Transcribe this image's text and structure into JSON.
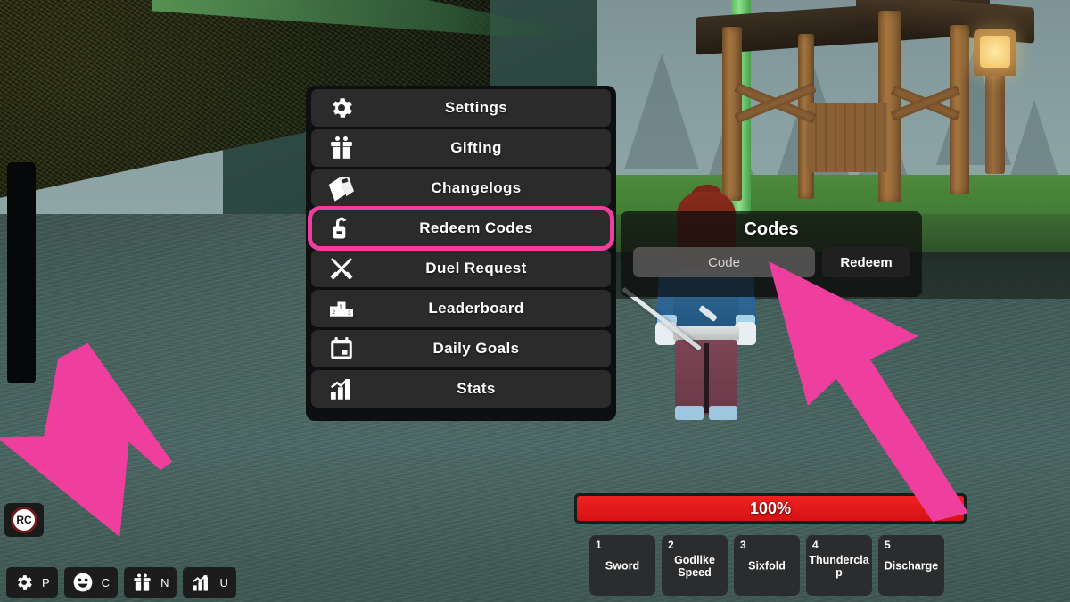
{
  "game": {
    "title": "Roblox game UI",
    "accent_pink": "#ef3f9e",
    "health_red": "#ee2222",
    "panel_dark": "#0d0f10",
    "row_dark": "#2b2b2c"
  },
  "menu": {
    "items": [
      {
        "label": "Settings",
        "icon": "gear-icon"
      },
      {
        "label": "Gifting",
        "icon": "gift-icon"
      },
      {
        "label": "Changelogs",
        "icon": "book-icon"
      },
      {
        "label": "Redeem Codes",
        "icon": "unlock-icon",
        "highlighted": true
      },
      {
        "label": "Duel Request",
        "icon": "crossed-swords-icon"
      },
      {
        "label": "Leaderboard",
        "icon": "podium-icon"
      },
      {
        "label": "Daily Goals",
        "icon": "calendar-icon"
      },
      {
        "label": "Stats",
        "icon": "bar-chart-icon"
      }
    ]
  },
  "codes_panel": {
    "title": "Codes",
    "input_placeholder": "Code",
    "input_value": "",
    "redeem_label": "Redeem"
  },
  "health": {
    "percent_label": "100%",
    "percent": 100
  },
  "hotbar": {
    "slots": [
      {
        "key": "1",
        "name": "Sword"
      },
      {
        "key": "2",
        "name": "Godlike Speed"
      },
      {
        "key": "3",
        "name": "Sixfold"
      },
      {
        "key": "4",
        "name": "Thunderclap"
      },
      {
        "key": "5",
        "name": "Discharge"
      }
    ]
  },
  "taskbar": {
    "badge_label": "RC",
    "buttons": [
      {
        "icon": "gear-icon",
        "key": "P"
      },
      {
        "icon": "emoji-icon",
        "key": "C"
      },
      {
        "icon": "gift-icon",
        "key": "N"
      },
      {
        "icon": "bar-chart-icon",
        "key": "U"
      }
    ]
  },
  "annotations": {
    "arrow_left": "down-left-arrow",
    "arrow_right": "up-left-arrow",
    "highlight_target": "Redeem Codes"
  }
}
